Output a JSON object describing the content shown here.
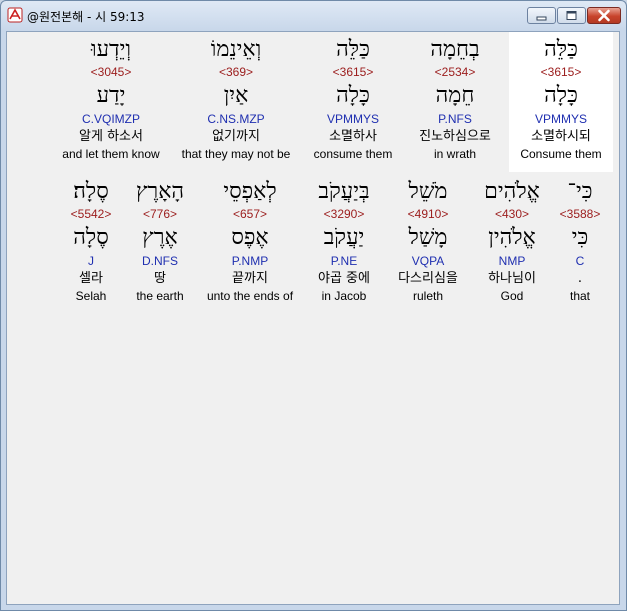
{
  "window": {
    "title": "@원전본해 - 시 59:13"
  },
  "verse": {
    "row1": [
      {
        "hebrew": "כַּלֵּה",
        "strong": "<3615>",
        "lemma": "כָּלָה",
        "parse": "VPMMYS",
        "korean": "소멸하시되",
        "english": "Consume them"
      },
      {
        "hebrew": "בְחֵמָה",
        "strong": "<2534>",
        "lemma": "חֵמָה",
        "parse": "P.NFS",
        "korean": "진노하심으로",
        "english": "in wrath"
      },
      {
        "hebrew": "כַּלֵּה",
        "strong": "<3615>",
        "lemma": "כָּלָה",
        "parse": "VPMMYS",
        "korean": "소멸하사",
        "english": "consume them"
      },
      {
        "hebrew": "וְאֵינֵמוֹ",
        "strong": "<369>",
        "lemma": "אַיִן",
        "parse": "C.NS.MZP",
        "korean": "없기까지",
        "english": "that they may not be"
      },
      {
        "hebrew": "וְיֵדְעוּ",
        "strong": "<3045>",
        "lemma": "יָדַע",
        "parse": "C.VQIMZP",
        "korean": "알게 하소서",
        "english": "and let them know"
      }
    ],
    "row2": [
      {
        "hebrew": "כִּי־",
        "strong": "<3588>",
        "lemma": "כִּי",
        "parse": "C",
        "korean": ".",
        "english": "that"
      },
      {
        "hebrew": "אֱלֹהִים",
        "strong": "<430>",
        "lemma": "אֱלֹהִין",
        "parse": "NMP",
        "korean": "하나님이",
        "english": "God"
      },
      {
        "hebrew": "מֹשֵׁל",
        "strong": "<4910>",
        "lemma": "מָשַׁל",
        "parse": "VQPA",
        "korean": "다스리심을",
        "english": "ruleth"
      },
      {
        "hebrew": "בְּיַעֲקֹב",
        "strong": "<3290>",
        "lemma": "יַעֲקֹב",
        "parse": "P.NE",
        "korean": "야곱 중에",
        "english": "in Jacob"
      },
      {
        "hebrew": "לְאַפְסֵי",
        "strong": "<657>",
        "lemma": "אֶפֶס",
        "parse": "P.NMP",
        "korean": "끝까지",
        "english": "unto the ends of"
      },
      {
        "hebrew": "הָאָרֶץ",
        "strong": "<776>",
        "lemma": "אֶרֶץ",
        "parse": "D.NFS",
        "korean": "땅",
        "english": "the earth"
      },
      {
        "hebrew": "סֶלָה׃",
        "strong": "<5542>",
        "lemma": "סֶלָה",
        "parse": "J",
        "korean": "셀라",
        "english": "Selah"
      }
    ]
  }
}
